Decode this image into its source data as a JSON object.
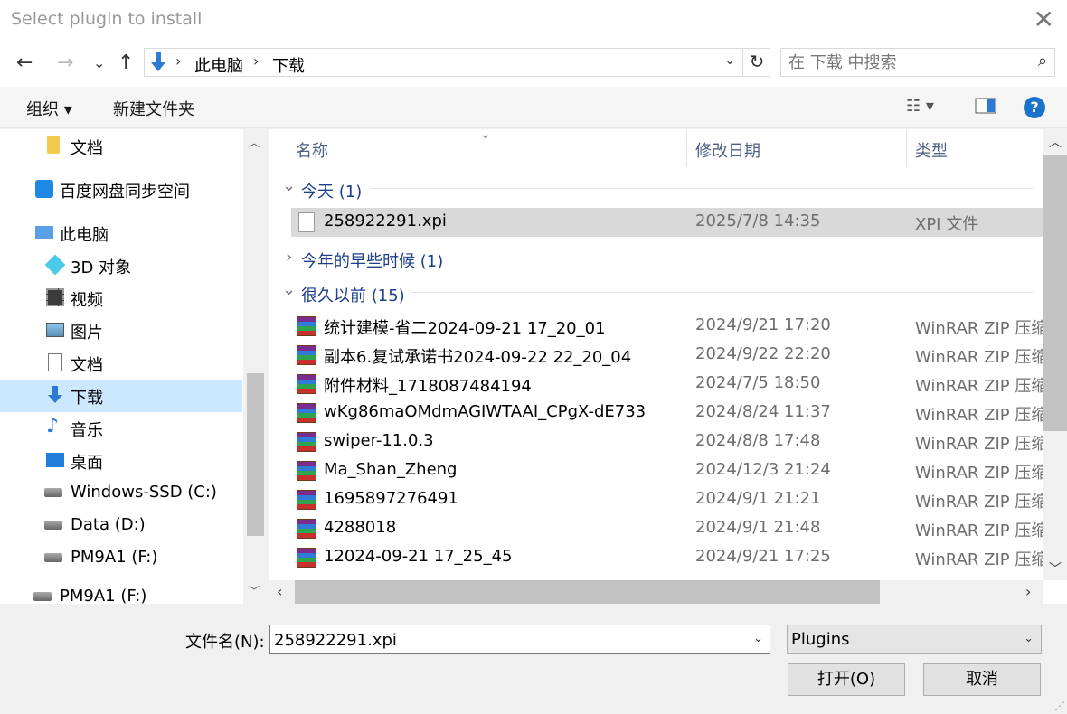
{
  "window": {
    "title": "Select plugin to install"
  },
  "nav_buttons": {
    "back": "←",
    "forward": "→",
    "recent": "⌄",
    "up": "↑"
  },
  "address": {
    "crumbs": [
      "此电脑",
      "下载"
    ],
    "refresh": "↻"
  },
  "search": {
    "placeholder": "在 下载 中搜索"
  },
  "toolbar": {
    "organize": "组织 ▾",
    "new_folder": "新建文件夹",
    "view_icon": "list-view-icon",
    "pane_icon": "preview-pane-icon",
    "help": "?"
  },
  "sidebar": {
    "items": [
      {
        "label": "文档",
        "icon": "folder-icon"
      },
      {
        "label": "百度网盘同步空间",
        "icon": "baidu-netdisk-icon"
      },
      {
        "label": "此电脑",
        "icon": "this-pc-icon"
      },
      {
        "label": "3D 对象",
        "icon": "3d-objects-icon"
      },
      {
        "label": "视频",
        "icon": "video-icon"
      },
      {
        "label": "图片",
        "icon": "pictures-icon"
      },
      {
        "label": "文档",
        "icon": "documents-icon"
      },
      {
        "label": "下载",
        "icon": "downloads-icon",
        "selected": true
      },
      {
        "label": "音乐",
        "icon": "music-icon"
      },
      {
        "label": "桌面",
        "icon": "desktop-icon"
      },
      {
        "label": "Windows-SSD (C:)",
        "icon": "drive-icon"
      },
      {
        "label": "Data (D:)",
        "icon": "drive-icon"
      },
      {
        "label": "PM9A1 (F:)",
        "icon": "drive-icon"
      },
      {
        "label": "PM9A1 (F:)",
        "icon": "drive-icon"
      }
    ]
  },
  "columns": {
    "name": "名称",
    "modified": "修改日期",
    "type": "类型"
  },
  "groups": {
    "today": "今天 (1)",
    "earlier_this_year": "今年的早些时候 (1)",
    "long_ago": "很久以前 (15)"
  },
  "files_today": [
    {
      "name": "258922291.xpi",
      "date": "2025/7/8 14:35",
      "type": "XPI 文件",
      "selected": true
    }
  ],
  "files_long_ago": [
    {
      "name": "统计建模-省二2024-09-21 17_20_01",
      "date": "2024/9/21 17:20",
      "type": "WinRAR ZIP 压缩"
    },
    {
      "name": "副本6.复试承诺书2024-09-22 22_20_04",
      "date": "2024/9/22 22:20",
      "type": "WinRAR ZIP 压缩"
    },
    {
      "name": "附件材料_1718087484194",
      "date": "2024/7/5 18:50",
      "type": "WinRAR ZIP 压缩"
    },
    {
      "name": "wKg86maOMdmAGIWTAAI_CPgX-dE733",
      "date": "2024/8/24 11:37",
      "type": "WinRAR ZIP 压缩"
    },
    {
      "name": "swiper-11.0.3",
      "date": "2024/8/8 17:48",
      "type": "WinRAR ZIP 压缩"
    },
    {
      "name": "Ma_Shan_Zheng",
      "date": "2024/12/3 21:24",
      "type": "WinRAR ZIP 压缩"
    },
    {
      "name": "1695897276491",
      "date": "2024/9/1 21:21",
      "type": "WinRAR ZIP 压缩"
    },
    {
      "name": "4288018",
      "date": "2024/9/1 21:48",
      "type": "WinRAR ZIP 压缩"
    },
    {
      "name": "12024-09-21 17_25_45",
      "date": "2024/9/21 17:25",
      "type": "WinRAR ZIP 压缩"
    }
  ],
  "footer": {
    "filename_label": "文件名(N):",
    "filename_value": "258922291.xpi",
    "filter": "Plugins",
    "open": "打开(O)",
    "cancel": "取消"
  },
  "colors": {
    "selection": "#cce8ff",
    "row_selected": "#d9d9d9",
    "group_text": "#1e3f8a",
    "help_bg": "#1a73c8"
  }
}
